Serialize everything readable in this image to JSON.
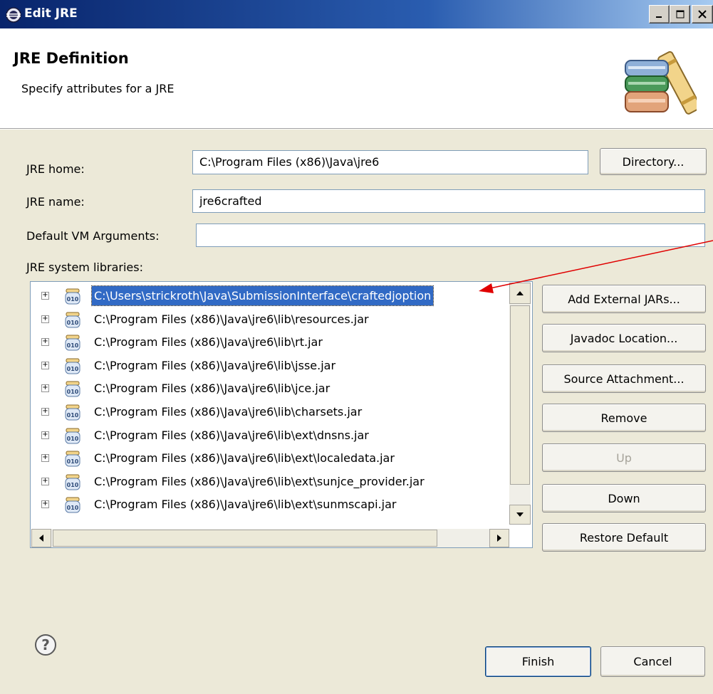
{
  "window": {
    "title": "Edit JRE",
    "minimize_label": "_",
    "maximize_label": "□",
    "close_label": "X"
  },
  "header": {
    "title": "JRE Definition",
    "subtitle": "Specify attributes for a JRE"
  },
  "form": {
    "jre_home_label": "JRE home:",
    "jre_home_value": "C:\\Program Files (x86)\\Java\\jre6",
    "directory_button": "Directory...",
    "jre_name_label": "JRE name:",
    "jre_name_value": "jre6crafted",
    "vm_args_label": "Default VM Arguments:",
    "vm_args_value": "",
    "libraries_label": "JRE system libraries:"
  },
  "libraries": [
    {
      "path": "C:\\Users\\strickroth\\Java\\SubmissionInterface\\craftedjoption",
      "selected": true
    },
    {
      "path": "C:\\Program Files (x86)\\Java\\jre6\\lib\\resources.jar",
      "selected": false
    },
    {
      "path": "C:\\Program Files (x86)\\Java\\jre6\\lib\\rt.jar",
      "selected": false
    },
    {
      "path": "C:\\Program Files (x86)\\Java\\jre6\\lib\\jsse.jar",
      "selected": false
    },
    {
      "path": "C:\\Program Files (x86)\\Java\\jre6\\lib\\jce.jar",
      "selected": false
    },
    {
      "path": "C:\\Program Files (x86)\\Java\\jre6\\lib\\charsets.jar",
      "selected": false
    },
    {
      "path": "C:\\Program Files (x86)\\Java\\jre6\\lib\\ext\\dnsns.jar",
      "selected": false
    },
    {
      "path": "C:\\Program Files (x86)\\Java\\jre6\\lib\\ext\\localedata.jar",
      "selected": false
    },
    {
      "path": "C:\\Program Files (x86)\\Java\\jre6\\lib\\ext\\sunjce_provider.jar",
      "selected": false
    },
    {
      "path": "C:\\Program Files (x86)\\Java\\jre6\\lib\\ext\\sunmscapi.jar",
      "selected": false
    }
  ],
  "side_buttons": {
    "add_external_jars": "Add External JARs...",
    "javadoc_location": "Javadoc Location...",
    "source_attachment": "Source Attachment...",
    "remove": "Remove",
    "up": "Up",
    "down": "Down",
    "restore_default": "Restore Default"
  },
  "footer": {
    "finish": "Finish",
    "cancel": "Cancel"
  },
  "colors": {
    "selection": "#316ac5",
    "annotation_arrow": "#e00000"
  }
}
